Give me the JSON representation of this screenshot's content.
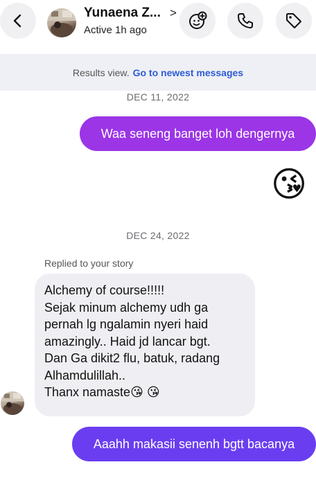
{
  "header": {
    "contact_name": "Yunaena Z...",
    "status": "Active 1h ago",
    "name_chevron": ">",
    "back_icon": "chevron-left-icon",
    "effects_icon": "sticker-plus-icon",
    "call_icon": "phone-icon",
    "tag_icon": "tag-icon"
  },
  "results_bar": {
    "text": "Results view.",
    "link": "Go to newest messages"
  },
  "messages": {
    "date1": "DEC 11, 2022",
    "out1": "Waa seneng banget loh dengernya",
    "emoji1": "😘",
    "date2": "DEC 24, 2022",
    "replied_label": "Replied to your story",
    "in1_lines": [
      "Alchemy of course!!!!!",
      "Sejak minum alchemy udh ga",
      "pernah lg ngalamin nyeri haid",
      "amazingly.. Haid jd lancar bgt.",
      "Dan Ga dikit2 flu, batuk, radang",
      "Alhamdulillah..",
      "Thanx namaste😘 😘"
    ],
    "out2": "Aaahh makasii senenh bgtt bacanya"
  },
  "colors": {
    "out1_bubble": "#9b35e6",
    "out2_bubble": "#6a3ef0",
    "link": "#2e5bd6",
    "incoming_bubble": "#efeff3"
  }
}
